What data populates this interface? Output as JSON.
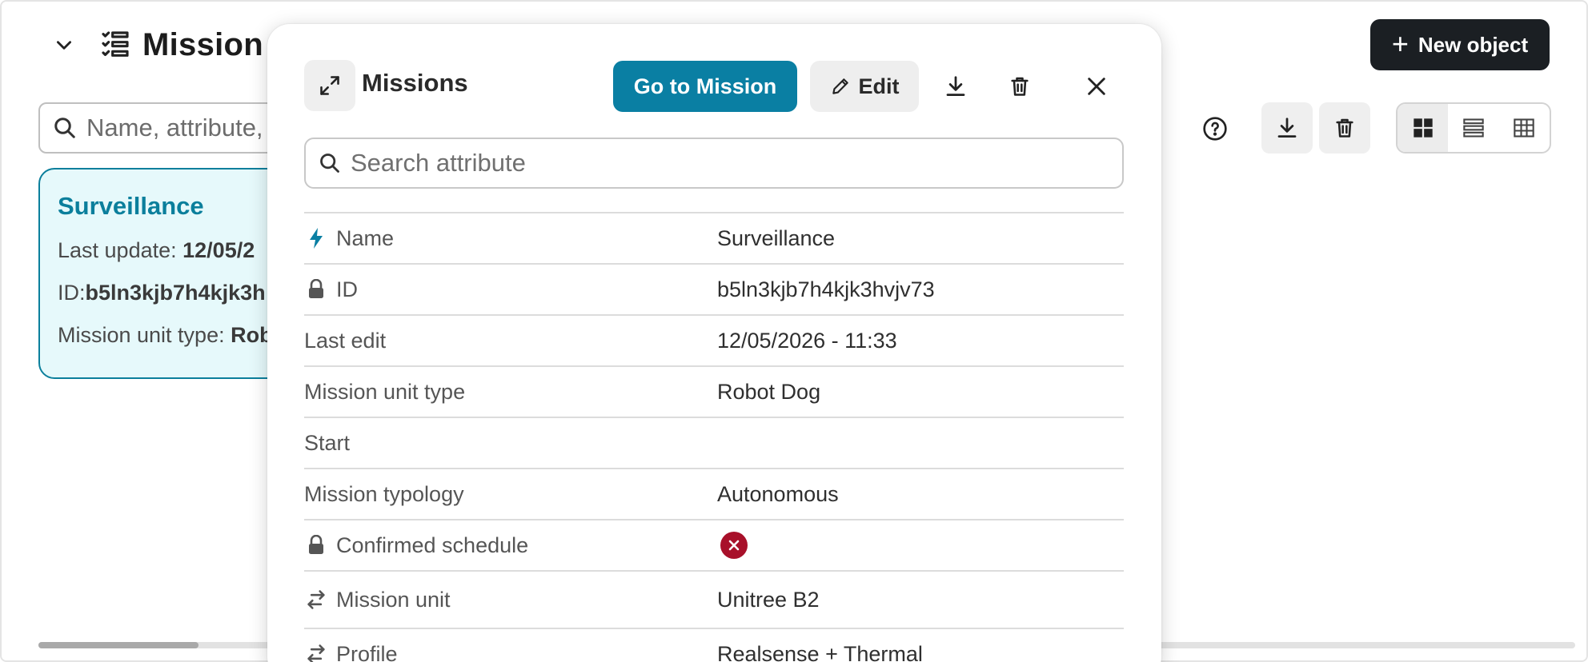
{
  "background": {
    "title": "Mission",
    "new_object_label": "New object",
    "search_placeholder": "Name, attribute,",
    "card": {
      "title": "Surveillance",
      "last_update_label": "Last update:",
      "last_update_value": "12/05/2",
      "id_label": "ID:",
      "id_value": "b5ln3kjb7h4kjk3h",
      "unit_type_label": "Mission unit type:",
      "unit_type_value": "Rob"
    },
    "icons": [
      "chevron-down-icon",
      "checklist-icon",
      "search-icon",
      "help-circle-icon",
      "download-icon",
      "trash-icon",
      "grid-view-icon",
      "list-view-icon",
      "table-view-icon"
    ]
  },
  "modal": {
    "title": "Missions",
    "go_to_label": "Go to Mission",
    "edit_label": "Edit",
    "search_placeholder": "Search attribute",
    "icons": [
      "expand-icon",
      "pencil-icon",
      "download-icon",
      "trash-icon",
      "close-icon"
    ],
    "attributes": [
      {
        "key": "Name",
        "value": "Surveillance",
        "icon": "bolt-icon"
      },
      {
        "key": "ID",
        "value": "b5ln3kjb7h4kjk3hvjv73",
        "icon": "lock-icon"
      },
      {
        "key": "Last edit",
        "value": "12/05/2026 - 11:33",
        "icon": ""
      },
      {
        "key": "Mission unit type",
        "value": "Robot Dog",
        "icon": ""
      },
      {
        "key": "Start",
        "value": "",
        "icon": ""
      },
      {
        "key": "Mission typology",
        "value": "Autonomous",
        "icon": ""
      },
      {
        "key": "Confirmed schedule",
        "value": "",
        "icon": "lock-icon",
        "status": "false",
        "status_color": "#a8102a"
      },
      {
        "key": "Mission unit",
        "value": "Unitree B2",
        "icon": "relation-icon"
      },
      {
        "key": "Profile",
        "value": "Realsense + Thermal",
        "icon": "relation-icon"
      }
    ]
  },
  "colors": {
    "accent": "#0a7fa3",
    "card_bg": "#e6f9fb",
    "dark_button": "#1b1f23",
    "error": "#a8102a"
  }
}
